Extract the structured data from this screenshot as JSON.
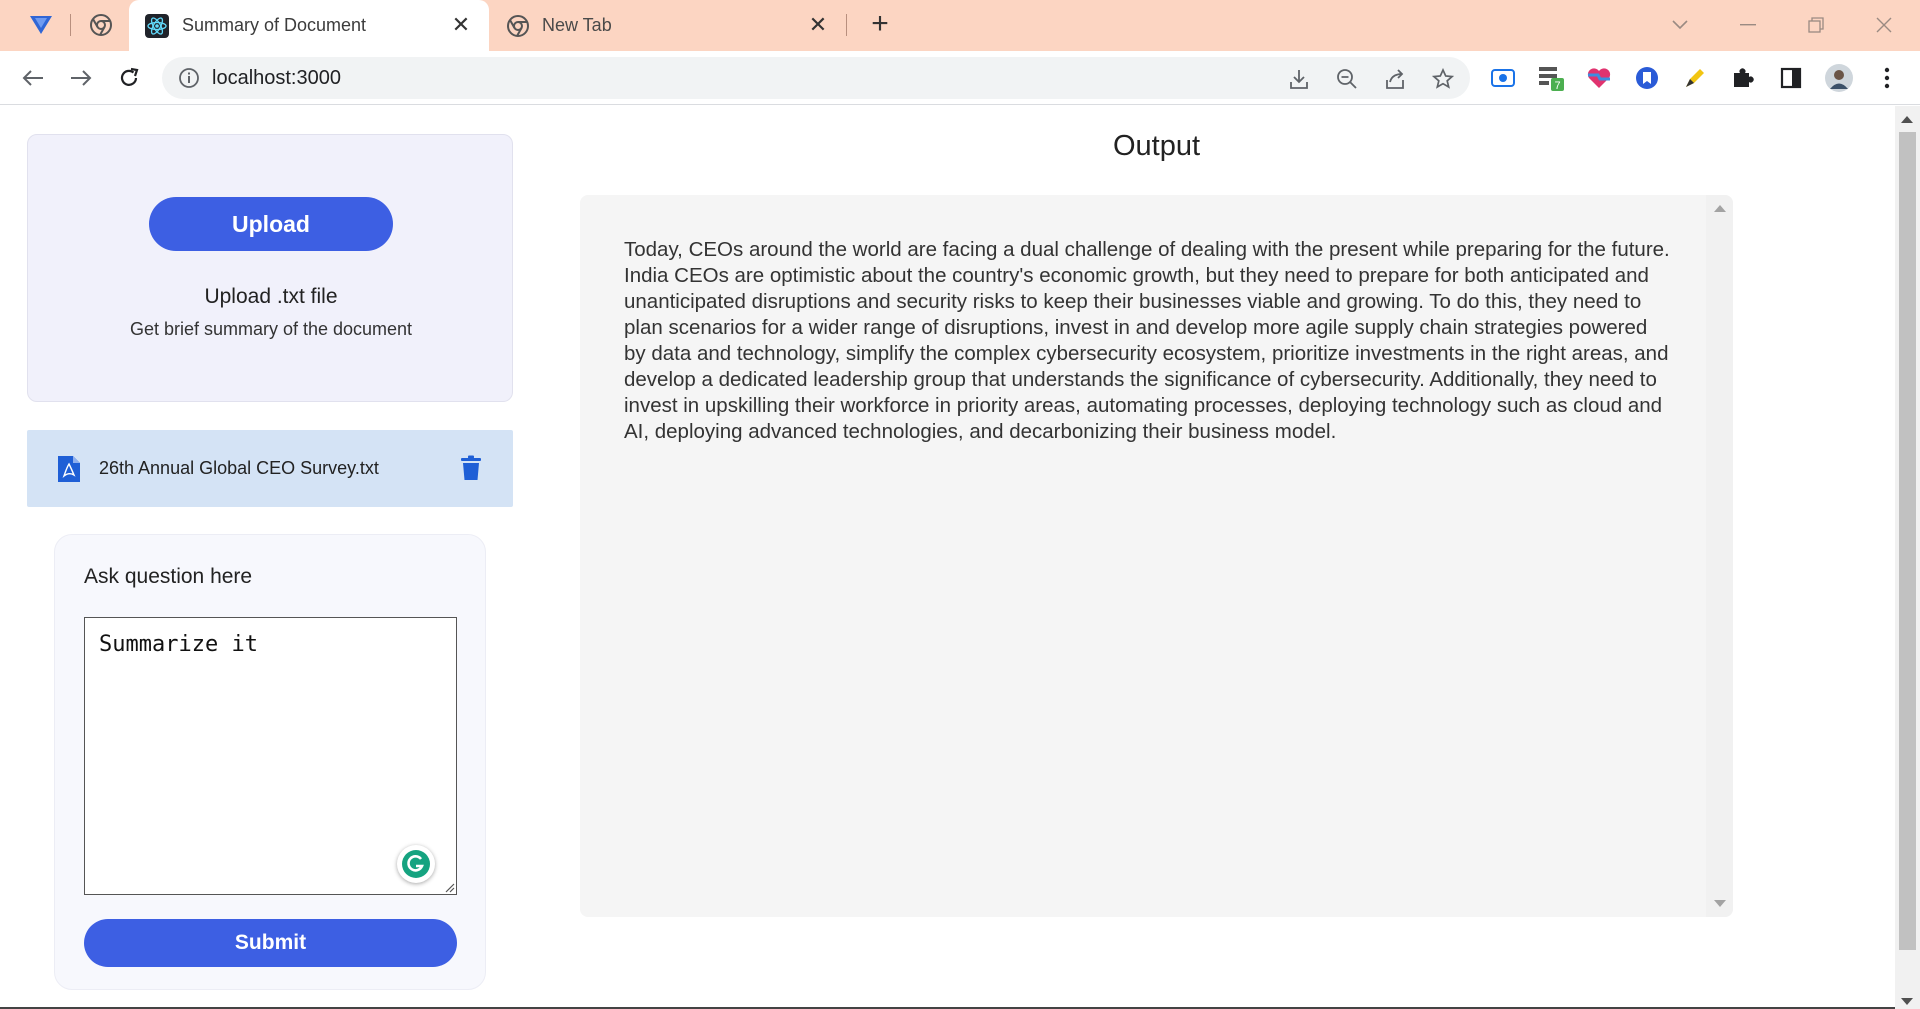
{
  "browser": {
    "tabs": [
      {
        "title": "Summary of Document",
        "active": true,
        "icon": "react-icon"
      },
      {
        "title": "New Tab",
        "active": false,
        "icon": "chrome-icon"
      }
    ],
    "address": {
      "url": "localhost:3000"
    },
    "extension_badge": "7"
  },
  "sidebar": {
    "upload_button": "Upload",
    "upload_title": "Upload .txt file",
    "upload_subtitle": "Get brief summary of the document",
    "file": {
      "name": "26th Annual Global CEO Survey.txt"
    },
    "question": {
      "label": "Ask question here",
      "value": "Summarize it",
      "submit_label": "Submit"
    }
  },
  "output": {
    "title": "Output",
    "text": "Today, CEOs around the world are facing a dual challenge of dealing with the present while preparing for the future. India CEOs are optimistic about the country's economic growth, but they need to prepare for both anticipated and unanticipated disruptions and security risks to keep their businesses viable and growing. To do this, they need to plan scenarios for a wider range of disruptions, invest in and develop more agile supply chain strategies powered by data and technology, simplify the complex cybersecurity ecosystem, prioritize investments in the right areas, and develop a dedicated leadership group that understands the significance of cybersecurity. Additionally, they need to invest in upskilling their workforce in priority areas, automating processes, deploying technology such as cloud and AI, deploying advanced technologies, and decarbonizing their business model."
  },
  "colors": {
    "tabstrip": "#fcd5c2",
    "primary_button": "#3d5fe3",
    "file_row": "#d4e3f5",
    "upload_card": "#f1f1fb",
    "output_box": "#f5f5f5"
  }
}
